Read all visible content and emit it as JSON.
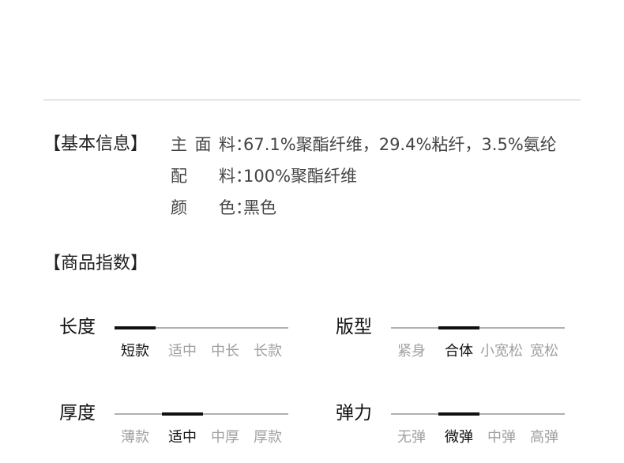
{
  "basic_info": {
    "title": "【基本信息】",
    "rows": [
      {
        "label": "主面料",
        "colon": "：",
        "value": "67.1%聚酯纤维，29.4%粘纤，3.5%氨纶"
      },
      {
        "label": "配料",
        "colon": "：",
        "value": "100%聚酯纤维"
      },
      {
        "label": "颜色",
        "colon": "：",
        "value": "黑色"
      }
    ]
  },
  "product_index": {
    "title": "【商品指数】",
    "items": [
      {
        "name": "长度",
        "options": [
          "短款",
          "适中",
          "中长",
          "长款"
        ],
        "selected_index": 0
      },
      {
        "name": "版型",
        "options": [
          "紧身",
          "合体",
          "小宽松",
          "宽松"
        ],
        "selected_index": 1
      },
      {
        "name": "厚度",
        "options": [
          "薄款",
          "适中",
          "中厚",
          "厚款"
        ],
        "selected_index": 1
      },
      {
        "name": "弹力",
        "options": [
          "无弹",
          "微弹",
          "中弹",
          "高弹"
        ],
        "selected_index": 1
      }
    ]
  }
}
